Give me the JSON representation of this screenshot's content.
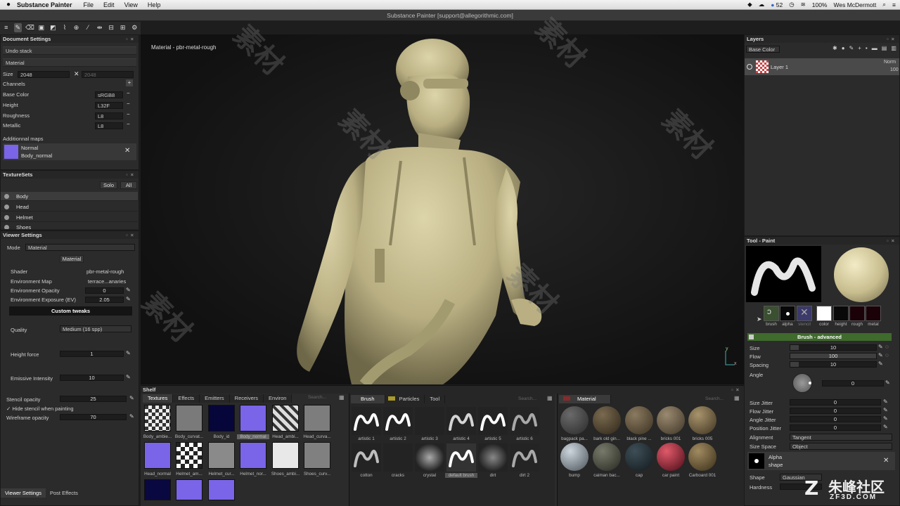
{
  "menubar": {
    "app": "Substance Painter",
    "items": [
      "File",
      "Edit",
      "View",
      "Help"
    ],
    "battery": "100%",
    "user": "Wes McDermott",
    "count": "52"
  },
  "window": {
    "title": "Substance Painter [support@allegorithmic.com]"
  },
  "document_settings": {
    "title": "Document Settings",
    "undo": "Undo stack",
    "material": "Material",
    "size_label": "Size",
    "size_value": "2048",
    "size_value2": "2048",
    "channels_label": "Channels",
    "channels": [
      {
        "name": "Base Color",
        "format": "sRGB8"
      },
      {
        "name": "Height",
        "format": "L32F"
      },
      {
        "name": "Roughness",
        "format": "L8"
      },
      {
        "name": "Metallic",
        "format": "L8"
      }
    ],
    "additional_maps": "Additionnal maps",
    "map_name": "Normal",
    "map_file": "Body_normal"
  },
  "texturesets": {
    "title": "TextureSets",
    "solo": "Solo",
    "all": "All",
    "items": [
      "Body",
      "Head",
      "Helmet",
      "Shoes"
    ]
  },
  "viewer_settings": {
    "title": "Viewer Settings",
    "mode_label": "Mode",
    "mode_value": "Material",
    "material_btn": "Material",
    "shader_label": "Shader",
    "shader_value": "pbr-metal-rough",
    "envmap_label": "Environment Map",
    "envmap_value": "terrace...anaries",
    "envop_label": "Environment Opacity",
    "envop_value": "0",
    "envexp_label": "Environment Exposure (EV)",
    "envexp_value": "2.05",
    "custom_tweaks": "Custom tweaks",
    "quality_label": "Quality",
    "quality_value": "Medium (16 spp)",
    "height_label": "Height force",
    "height_value": "1",
    "emissive_label": "Emissive Intensity",
    "emissive_value": "10",
    "stencil_label": "Stencil opacity",
    "stencil_value": "25",
    "hide_stencil": "Hide stencil when painting",
    "wire_label": "Wireframe opacity",
    "wire_value": "70",
    "tabs": [
      "Viewer Settings",
      "Post Effects"
    ]
  },
  "viewport": {
    "label": "Material - pbr-metal-rough"
  },
  "shelf": {
    "title": "Shelf",
    "tabs": [
      "Textures",
      "Effects",
      "Emitters",
      "Receivers",
      "Environ"
    ],
    "search": "Search...",
    "textures": [
      "Body_ambie...",
      "Body_curvat...",
      "Body_id",
      "Body_normal",
      "Head_ambi...",
      "Head_curva...",
      "Head_normal",
      "Helmet_am...",
      "Helmet_cur...",
      "Helmet_nor...",
      "Shoes_ambi...",
      "Shoes_curv..."
    ],
    "brush_tabs": [
      "Brush",
      "Particles",
      "Tool"
    ],
    "brushes": [
      "artistic 1",
      "artistic 2",
      "artistic 3",
      "artistic 4",
      "artistic 5",
      "artistic 6",
      "cotton",
      "cracks",
      "crystal",
      "default brush",
      "dirt",
      "dirt 2"
    ],
    "material_tab": "Material",
    "materials": [
      "bagpack pa...",
      "bark old gin...",
      "black pine ...",
      "bricks 001",
      "bricks 005",
      "bump",
      "caiman bac...",
      "cap",
      "car paint",
      "Carboard 001"
    ]
  },
  "layers": {
    "title": "Layers",
    "channel": "Base Color",
    "layer_name": "Layer 1",
    "blend": "Norm",
    "opacity": "100"
  },
  "tool": {
    "title": "Tool - Paint",
    "channels": [
      "brush",
      "alpha",
      "stencil",
      "color",
      "height",
      "rough",
      "metal"
    ],
    "section": "Brush - advanced",
    "size_label": "Size",
    "size_value": "10",
    "flow_label": "Flow",
    "flow_value": "100",
    "spacing_label": "Spacing",
    "spacing_value": "10",
    "angle_label": "Angle",
    "angle_value": "0",
    "sj_label": "Size Jitter",
    "sj_value": "0",
    "fj_label": "Flow Jitter",
    "fj_value": "0",
    "aj_label": "Angle Jitter",
    "aj_value": "0",
    "pj_label": "Position Jitter",
    "pj_value": "0",
    "align_label": "Alignment",
    "align_value": "Tangent",
    "space_label": "Size Space",
    "space_value": "Object",
    "alpha_label": "Alpha",
    "alpha_sub": "shape",
    "shape_label": "Shape",
    "shape_value": "Gaussian",
    "hard_label": "Hardness"
  },
  "watermark": {
    "site": "朱峰社区",
    "url": "ZF3D.COM",
    "cn": "素材"
  },
  "colors": {
    "accent_green": "#3f6b2d",
    "normal_purple": "#7a64e8",
    "skin": "#cfc69a"
  }
}
